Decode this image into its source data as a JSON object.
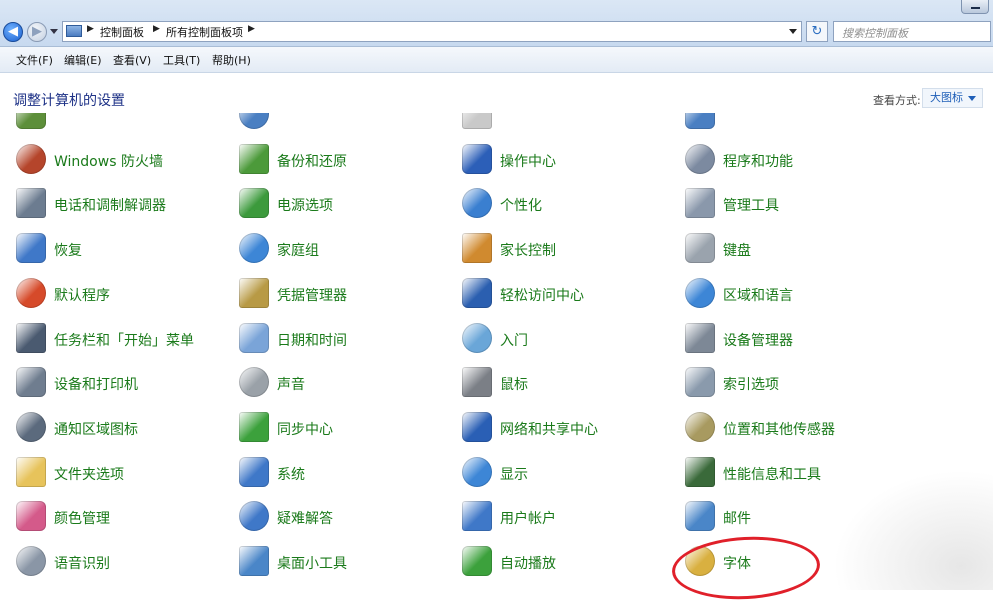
{
  "window": {
    "breadcrumbs": [
      "控制面板",
      "所有控制面板项"
    ],
    "search_placeholder": "搜索控制面板"
  },
  "menu": [
    "文件(F)",
    "编辑(E)",
    "查看(V)",
    "工具(T)",
    "帮助(H)"
  ],
  "header": {
    "title": "调整计算机的设置",
    "view_by_label": "查看方式:",
    "view_by_value": "大图标"
  },
  "items": [
    {
      "label": "",
      "icon": "partial-icon",
      "color": "#5d8f3a"
    },
    {
      "label": "",
      "icon": "partial-icon",
      "color": "#4a7fc2"
    },
    {
      "label": "",
      "icon": "partial-icon",
      "color": "#c9c9c9"
    },
    {
      "label": "",
      "icon": "partial-icon",
      "color": "#4a7fc2"
    },
    {
      "label": "Windows 防火墙",
      "icon": "firewall-icon",
      "color": "#b5452b"
    },
    {
      "label": "备份和还原",
      "icon": "backup-icon",
      "color": "#4c9a3a"
    },
    {
      "label": "操作中心",
      "icon": "flag-icon",
      "color": "#2c5fb8"
    },
    {
      "label": "程序和功能",
      "icon": "programs-icon",
      "color": "#7c8aa0"
    },
    {
      "label": "电话和调制解调器",
      "icon": "phone-icon",
      "color": "#6c7c90"
    },
    {
      "label": "电源选项",
      "icon": "power-icon",
      "color": "#3c9a3c"
    },
    {
      "label": "个性化",
      "icon": "personalize-icon",
      "color": "#3a7fd0"
    },
    {
      "label": "管理工具",
      "icon": "admin-tools-icon",
      "color": "#8a98ab"
    },
    {
      "label": "恢复",
      "icon": "recovery-icon",
      "color": "#3f78c8"
    },
    {
      "label": "家庭组",
      "icon": "homegroup-icon",
      "color": "#3d86d6"
    },
    {
      "label": "家长控制",
      "icon": "parental-icon",
      "color": "#d08a2f"
    },
    {
      "label": "键盘",
      "icon": "keyboard-icon",
      "color": "#9aa3ad"
    },
    {
      "label": "默认程序",
      "icon": "default-programs-icon",
      "color": "#d64a2a"
    },
    {
      "label": "凭据管理器",
      "icon": "credential-icon",
      "color": "#b89a45"
    },
    {
      "label": "轻松访问中心",
      "icon": "ease-access-icon",
      "color": "#2b5fb0"
    },
    {
      "label": "区域和语言",
      "icon": "region-icon",
      "color": "#3d86d6"
    },
    {
      "label": "任务栏和「开始」菜单",
      "icon": "taskbar-icon",
      "color": "#4a5a70"
    },
    {
      "label": "日期和时间",
      "icon": "clock-icon",
      "color": "#7aa4d8"
    },
    {
      "label": "入门",
      "icon": "getting-started-icon",
      "color": "#6aa6d8"
    },
    {
      "label": "设备管理器",
      "icon": "device-manager-icon",
      "color": "#7d8896"
    },
    {
      "label": "设备和打印机",
      "icon": "printer-icon",
      "color": "#6f7d8f"
    },
    {
      "label": "声音",
      "icon": "sound-icon",
      "color": "#9aa1a8"
    },
    {
      "label": "鼠标",
      "icon": "mouse-icon",
      "color": "#7b7f86"
    },
    {
      "label": "索引选项",
      "icon": "index-icon",
      "color": "#8a9aac"
    },
    {
      "label": "通知区域图标",
      "icon": "notification-icon",
      "color": "#5b6a7d"
    },
    {
      "label": "同步中心",
      "icon": "sync-icon",
      "color": "#3ca13c"
    },
    {
      "label": "网络和共享中心",
      "icon": "network-icon",
      "color": "#2a5fb5"
    },
    {
      "label": "位置和其他传感器",
      "icon": "sensor-icon",
      "color": "#a89a60"
    },
    {
      "label": "文件夹选项",
      "icon": "folder-icon",
      "color": "#e7c35b"
    },
    {
      "label": "系统",
      "icon": "system-icon",
      "color": "#3f78c8"
    },
    {
      "label": "显示",
      "icon": "display-icon",
      "color": "#3d86d6"
    },
    {
      "label": "性能信息和工具",
      "icon": "performance-icon",
      "color": "#3a6a3a"
    },
    {
      "label": "颜色管理",
      "icon": "color-icon",
      "color": "#d45a8a"
    },
    {
      "label": "疑难解答",
      "icon": "troubleshoot-icon",
      "color": "#3f78c8"
    },
    {
      "label": "用户帐户",
      "icon": "users-icon",
      "color": "#3f78c8"
    },
    {
      "label": "邮件",
      "icon": "mail-icon",
      "color": "#4a86c8"
    },
    {
      "label": "语音识别",
      "icon": "microphone-icon",
      "color": "#8a96a6"
    },
    {
      "label": "桌面小工具",
      "icon": "gadgets-icon",
      "color": "#4a86c8"
    },
    {
      "label": "自动播放",
      "icon": "autoplay-icon",
      "color": "#3ca13c"
    },
    {
      "label": "字体",
      "icon": "fonts-icon",
      "color": "#d9b040"
    }
  ]
}
